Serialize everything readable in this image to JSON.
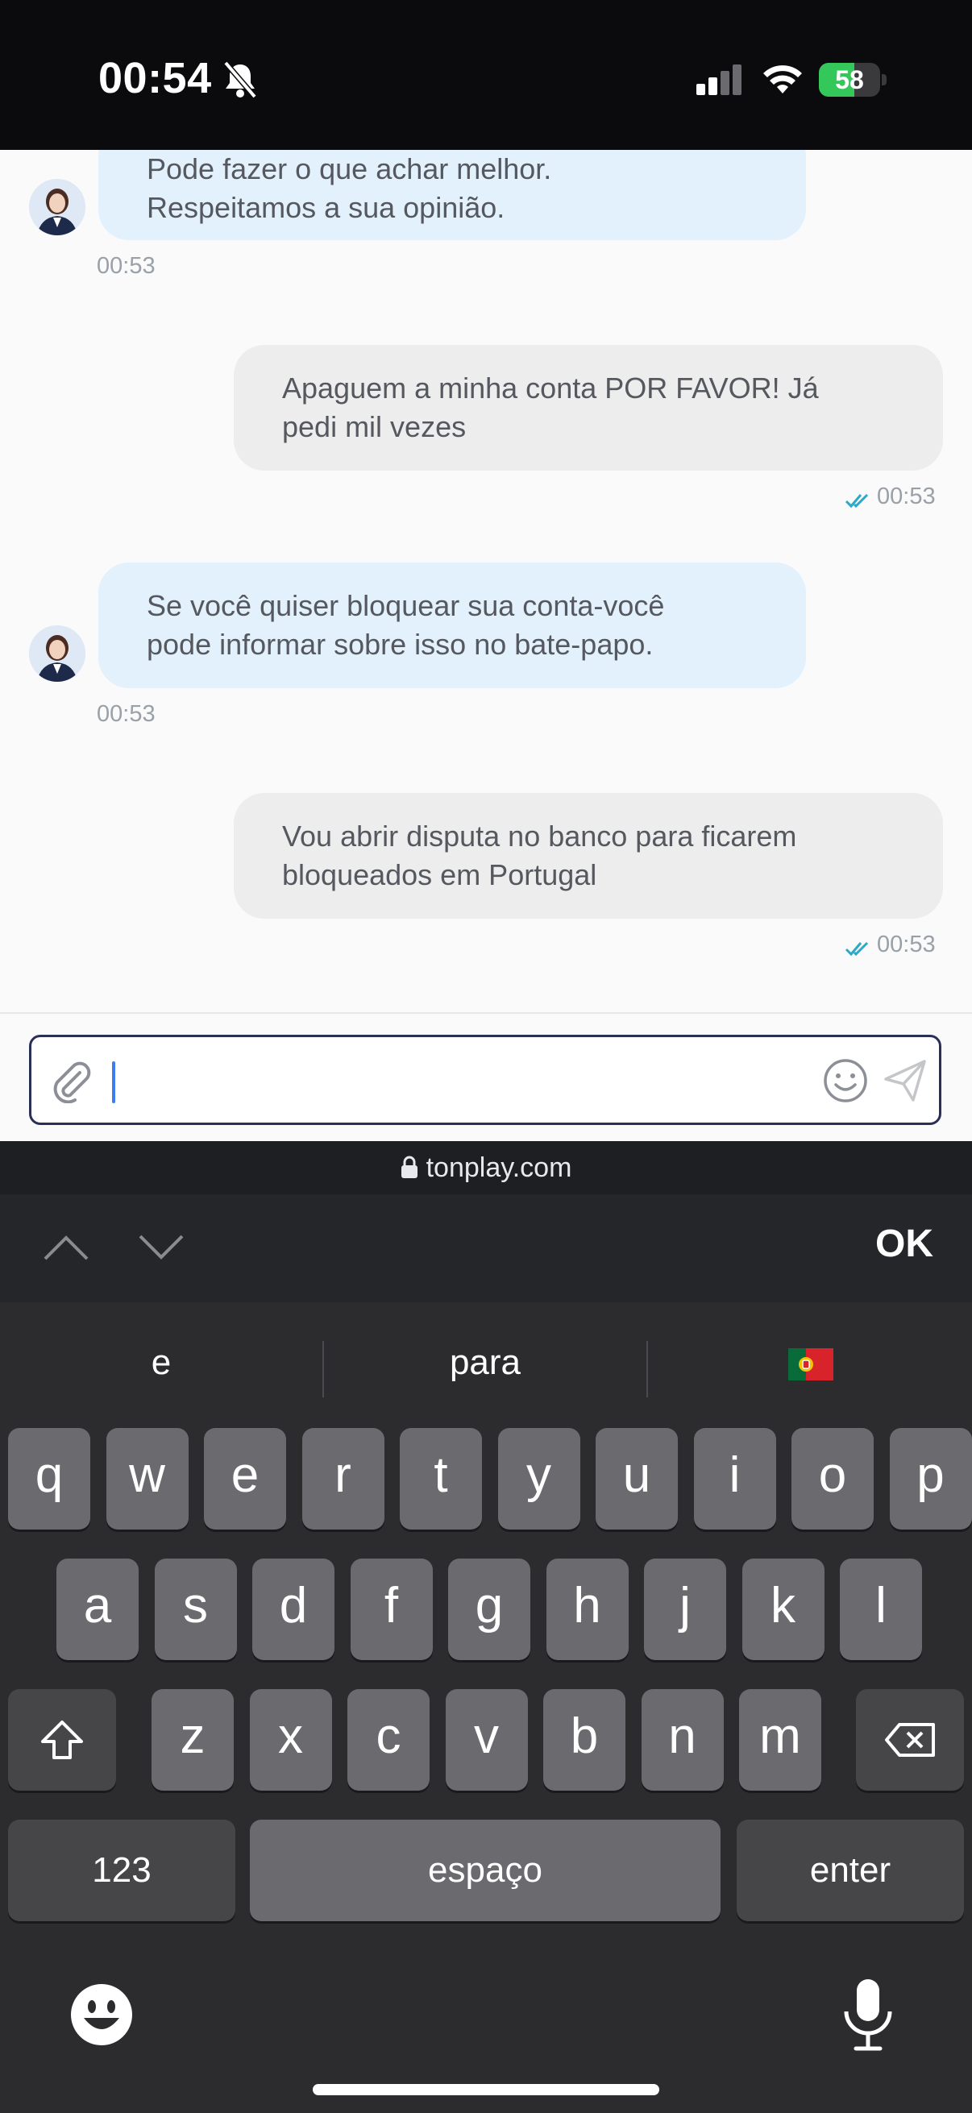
{
  "status_bar": {
    "time": "00:54",
    "battery_level": "58"
  },
  "chat": {
    "messages": [
      {
        "side": "incoming",
        "lines": [
          "Pode fazer o que achar melhor.",
          "Respeitamos a sua opinião."
        ],
        "time": "00:53"
      },
      {
        "side": "outgoing",
        "lines": [
          "Apaguem a minha conta POR FAVOR! Já",
          "pedi mil vezes"
        ],
        "time": "00:53"
      },
      {
        "side": "incoming",
        "lines": [
          "Se você quiser bloquear sua conta-você",
          "pode informar sobre isso no bate-papo."
        ],
        "time": "00:53"
      },
      {
        "side": "outgoing",
        "lines": [
          "Vou abrir disputa no banco para ficarem",
          "bloqueados em Portugal"
        ],
        "time": "00:53"
      }
    ]
  },
  "composer": {
    "value": ""
  },
  "url_bar": {
    "domain": "tonplay.com"
  },
  "keyboard_toolbar": {
    "ok_label": "OK"
  },
  "keyboard": {
    "suggestions": [
      "e",
      "para"
    ],
    "suggestion_flag": "portugal-flag-icon",
    "row1": [
      "q",
      "w",
      "e",
      "r",
      "t",
      "y",
      "u",
      "i",
      "o",
      "p"
    ],
    "row2": [
      "a",
      "s",
      "d",
      "f",
      "g",
      "h",
      "j",
      "k",
      "l"
    ],
    "row3": [
      "z",
      "x",
      "c",
      "v",
      "b",
      "n",
      "m"
    ],
    "numbers_label": "123",
    "space_label": "espaço",
    "enter_label": "enter"
  },
  "colors": {
    "incoming_bubble": "#e3f1fd",
    "outgoing_bubble": "#ededee",
    "read_check": "#2aa9c9",
    "composer_border": "#2b2f55",
    "battery_fill": "#34c759"
  }
}
